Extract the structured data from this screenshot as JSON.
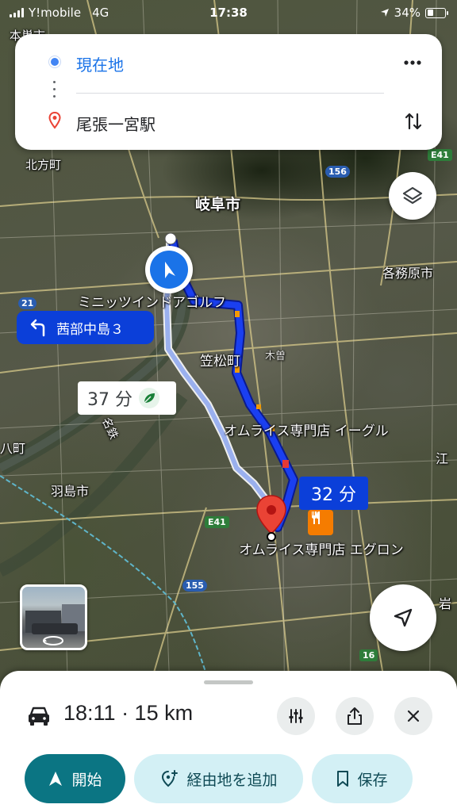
{
  "status_bar": {
    "carrier": "Y!mobile",
    "network": "4G",
    "time": "17:38",
    "battery": "34%",
    "battery_level": 0.34
  },
  "route": {
    "origin": "現在地",
    "destination": "尾張一宮駅"
  },
  "map": {
    "labels": {
      "honsu": "本巣市",
      "kitagata": "北方町",
      "gifu": "岐阜市",
      "kakamigahara": "各務原市",
      "minitsu": "ミニッツインドアゴルフ",
      "kasamatsu": "笠松町",
      "kiso": "木曽",
      "meitetsu": "名鉄",
      "hashima": "羽島市",
      "hachiya": "八町",
      "ko": "江",
      "iwa": "岩",
      "poi_top": "オムライス専門店 イーグル",
      "poi_dest": "オムライス専門店 エグロン"
    },
    "shields": {
      "e41a": "E41",
      "r156": "156",
      "r21": "21",
      "e41b": "E41",
      "r155": "155",
      "r16": "16"
    }
  },
  "chips": {
    "turn": "茜部中島３",
    "alt_time": "37 分",
    "main_time": "32 分"
  },
  "sheet": {
    "summary": "18:11 · 15 km",
    "start_label": "開始",
    "add_stop_label": "経由地を追加",
    "save_label": "保存"
  },
  "colors": {
    "route": "#1a3ff0",
    "accent": "#0b7583",
    "chip_bg": "#d3f0f5"
  }
}
